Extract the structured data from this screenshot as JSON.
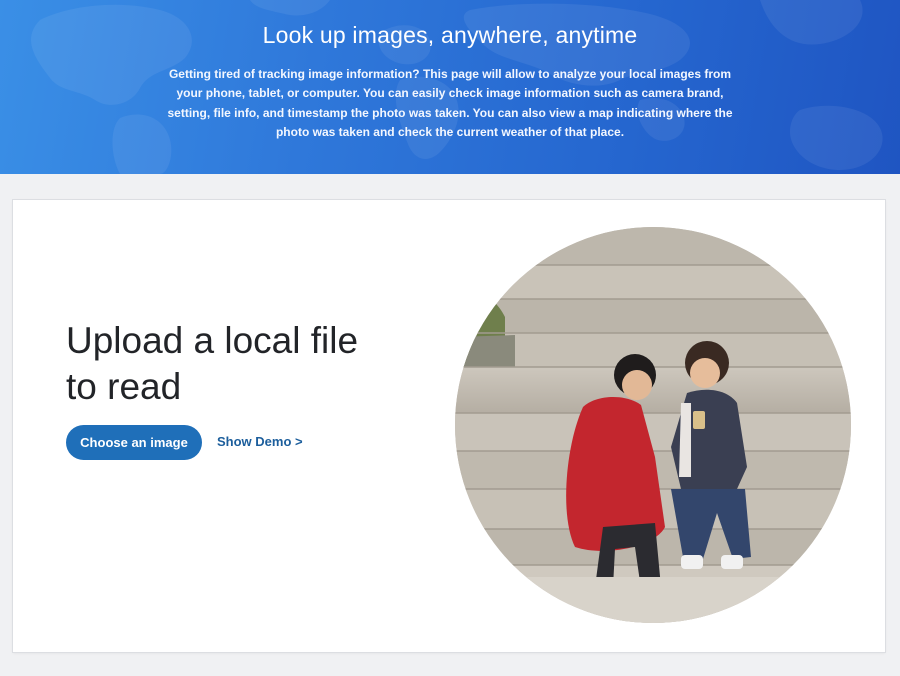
{
  "hero": {
    "title": "Look up images, anywhere, anytime",
    "description": "Getting tired of tracking image information? This page will allow to analyze your local images from your phone, tablet, or computer. You can easily check image information such as camera brand, setting, file info, and timestamp the photo was taken. You can also view a map indicating where the photo was taken and check the current weather of that place."
  },
  "upload": {
    "title": "Upload a local file to read",
    "choose_button": "Choose an image",
    "demo_link": "Show Demo >"
  },
  "colors": {
    "accent": "#1f6fb9",
    "link": "#1c5e9c",
    "hero_start": "#3a8fe6",
    "hero_end": "#1f55c2"
  },
  "icons": {
    "hero_background": "world-map-icon",
    "photo": "sample-photo-image"
  }
}
